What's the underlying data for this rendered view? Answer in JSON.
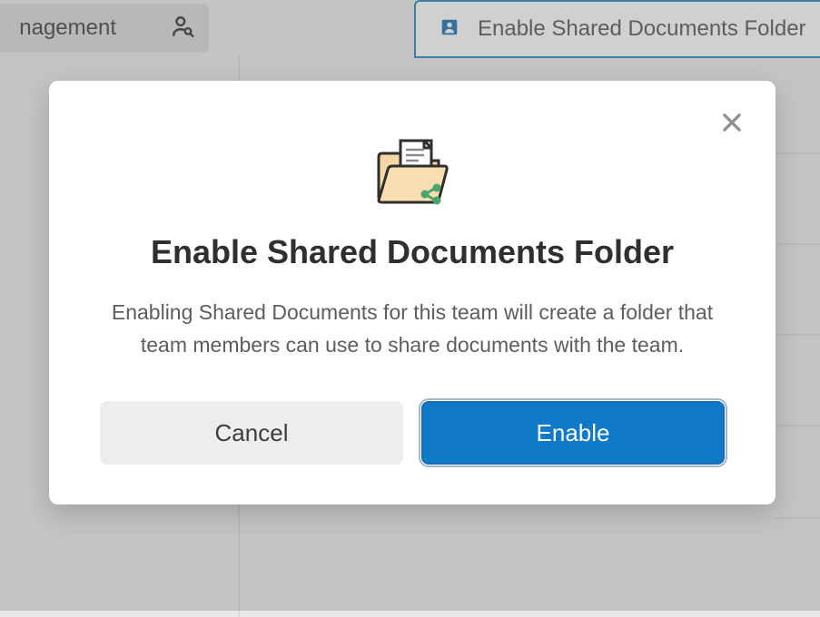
{
  "background": {
    "left_pill_label": "nagement",
    "top_card_label": "Enable Shared Documents Folder"
  },
  "modal": {
    "title": "Enable Shared Documents Folder",
    "description": "Enabling Shared Documents for this team will create a folder that team members can use to share documents with the team.",
    "cancel_label": "Cancel",
    "confirm_label": "Enable"
  }
}
